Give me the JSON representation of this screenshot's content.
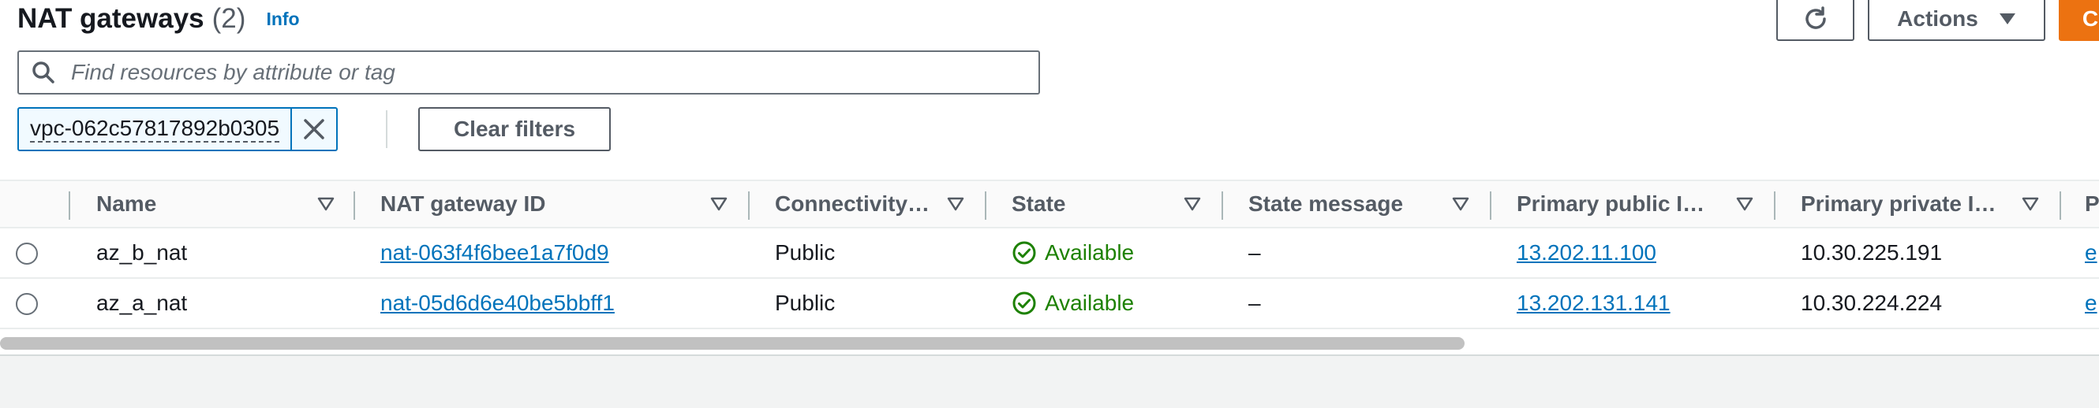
{
  "header": {
    "title": "NAT gateways",
    "count": "(2)",
    "info_link": "Info",
    "refresh_icon": "refresh-icon",
    "actions_label": "Actions",
    "actions_icon": "caret-down-icon",
    "primary_label": "C"
  },
  "search": {
    "placeholder": "Find resources by attribute or tag",
    "value": "",
    "icon": "search-icon"
  },
  "filter_token": {
    "value": "vpc-062c57817892b0305",
    "remove_icon": "close-icon"
  },
  "clear_filters_label": "Clear filters",
  "table": {
    "columns": [
      {
        "label": "Name"
      },
      {
        "label": "NAT gateway ID"
      },
      {
        "label": "Connectivity…"
      },
      {
        "label": "State"
      },
      {
        "label": "State message"
      },
      {
        "label": "Primary public I…"
      },
      {
        "label": "Primary private I…"
      },
      {
        "label": "P"
      }
    ],
    "rows": [
      {
        "name": "az_b_nat",
        "id": "nat-063f4f6bee1a7f0d9",
        "connectivity": "Public",
        "state": "Available",
        "state_message": "–",
        "public_ip": "13.202.11.100",
        "private_ip": "10.30.225.191",
        "extra": "e"
      },
      {
        "name": "az_a_nat",
        "id": "nat-05d6d6e40be5bbff1",
        "connectivity": "Public",
        "state": "Available",
        "state_message": "–",
        "public_ip": "13.202.131.141",
        "private_ip": "10.30.224.224",
        "extra": "e"
      }
    ]
  },
  "colors": {
    "link": "#0073bb",
    "success": "#1d8102",
    "primary": "#ec7211"
  }
}
